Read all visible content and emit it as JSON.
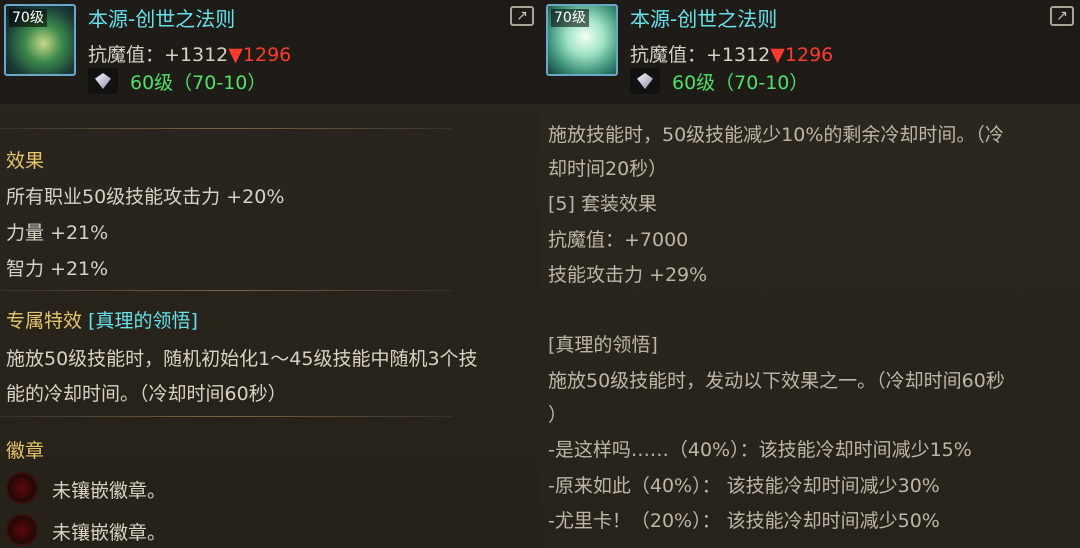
{
  "left_item": {
    "level_badge": "70级",
    "name": "本源-创世之法则",
    "stat_label": "抗魔值：+1312",
    "stat_down": "▼1296",
    "grade": "60级（70-10）",
    "sections": {
      "effect_title": "效果",
      "effect_lines": [
        "所有职业50级技能攻击力 +20%",
        "力量 +21%",
        "智力 +21%"
      ],
      "special_title": "专属特效",
      "special_name": "[真理的领悟]",
      "special_lines": [
        "施放50级技能时，随机初始化1～45级技能中随机3个技",
        "能的冷却时间。（冷却时间60秒）"
      ],
      "badge_title": "徽章",
      "badge_slots": [
        "未镶嵌徽章。",
        "未镶嵌徽章。"
      ]
    }
  },
  "right_item": {
    "level_badge": "70级",
    "name": "本源-创世之法则",
    "stat_label": "抗魔值：+1312",
    "stat_down": "▼1296",
    "grade": "60级（70-10）",
    "lines": [
      "施放技能时，50级技能减少10%的剩余冷却时间。（冷",
      "却时间20秒）",
      "[5] 套装效果",
      "抗魔值：+7000",
      "技能攻击力 +29%",
      "",
      "[真理的领悟]",
      "施放50级技能时，发动以下效果之一。（冷却时间60秒",
      "）",
      "-是这样吗……（40%）：该技能冷却时间减少15%",
      "-原来如此（40%）： 该技能冷却时间减少30%",
      "-尤里卡！（20%）： 该技能冷却时间减少50%"
    ]
  },
  "icons": {
    "share": "share-icon",
    "gem": "diamond-gem-icon",
    "badge": "empty-badge-slot-icon"
  },
  "colors": {
    "title_cyan": "#66e0ea",
    "section_gold": "#e7c56a",
    "decrease_red": "#ff3b30",
    "grade_green": "#4fe06a"
  }
}
